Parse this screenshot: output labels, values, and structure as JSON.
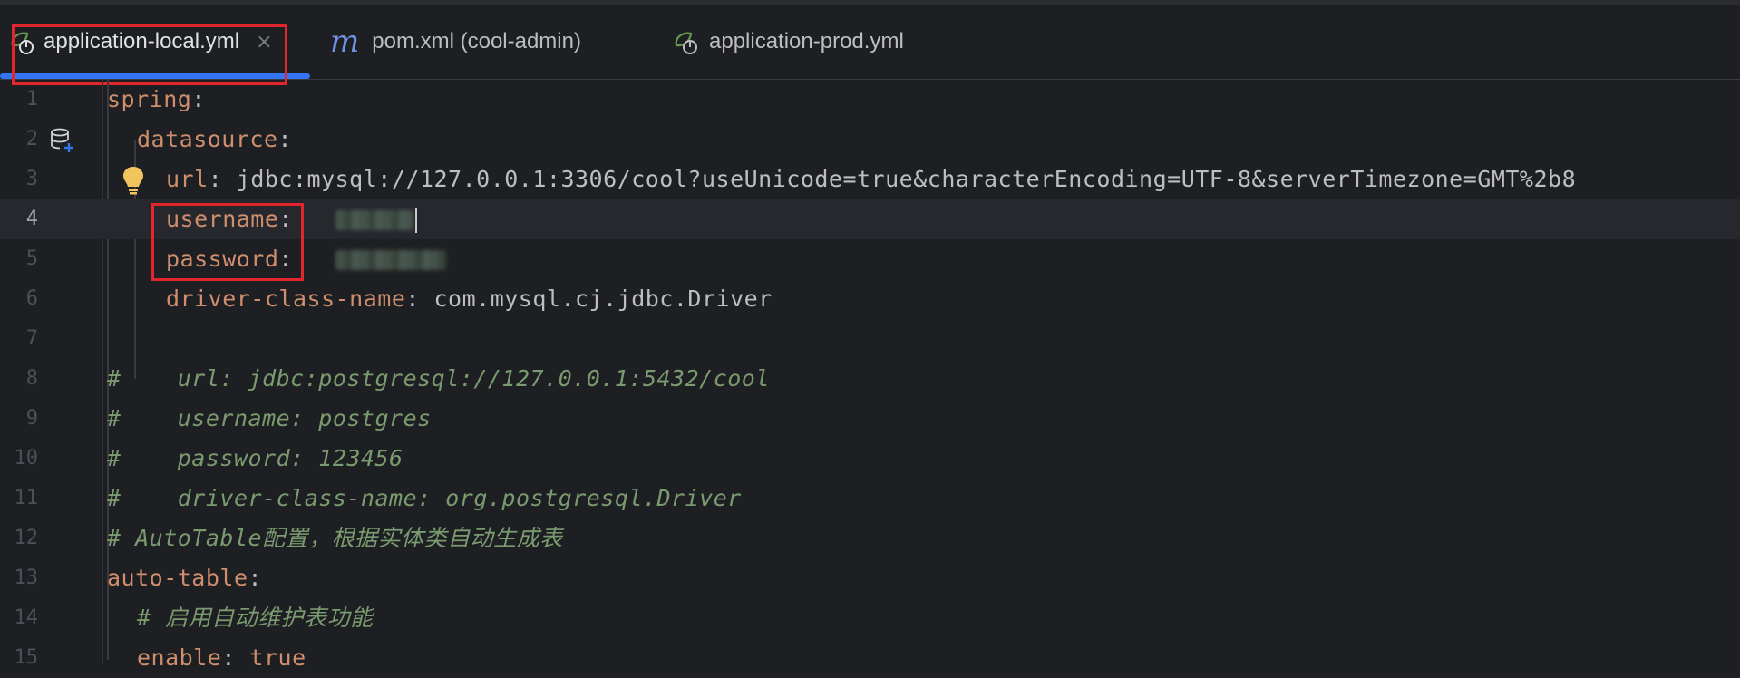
{
  "tabs": [
    {
      "label": "application-local.yml",
      "active": true,
      "icon": "spring-config-icon"
    },
    {
      "label": "pom.xml (cool-admin)",
      "active": false,
      "icon": "maven-icon",
      "icon_glyph": "m"
    },
    {
      "label": "application-prod.yml",
      "active": false,
      "icon": "spring-config-icon"
    }
  ],
  "tab_close_glyph": "×",
  "colors": {
    "accent": "#3574f0",
    "highlight": "#e3252d",
    "key": "#cf8e6d",
    "comment": "#7a9a70"
  },
  "line_numbers": [
    "1",
    "2",
    "3",
    "4",
    "5",
    "6",
    "7",
    "8",
    "9",
    "10",
    "11",
    "12",
    "13",
    "14",
    "15"
  ],
  "current_line": "4",
  "lines": {
    "l1": {
      "key": "spring",
      "colon": ":"
    },
    "l2": {
      "key": "datasource",
      "colon": ":"
    },
    "l3": {
      "key": "url",
      "colon": ":",
      "value": " jdbc:mysql://127.0.0.1:3306/cool?useUnicode=true&characterEncoding=UTF-8&serverTimezone=GMT%2b8"
    },
    "l4": {
      "key": "username",
      "colon": ":"
    },
    "l5": {
      "key": "password",
      "colon": ":"
    },
    "l6": {
      "key": "driver-class-name",
      "colon": ":",
      "value": " com.mysql.cj.jdbc.Driver"
    },
    "l8": {
      "comment": "#    url: jdbc:postgresql://127.0.0.1:5432/cool"
    },
    "l9": {
      "comment": "#    username: postgres"
    },
    "l10": {
      "comment": "#    password: 123456"
    },
    "l11": {
      "comment": "#    driver-class-name: org.postgresql.Driver"
    },
    "l12": {
      "comment": "# AutoTable配置，根据实体类自动生成表"
    },
    "l13": {
      "key": "auto-table",
      "colon": ":"
    },
    "l14": {
      "comment": "# 启用自动维护表功能"
    },
    "l15": {
      "key": "enable",
      "colon": ":",
      "value": " true"
    }
  }
}
